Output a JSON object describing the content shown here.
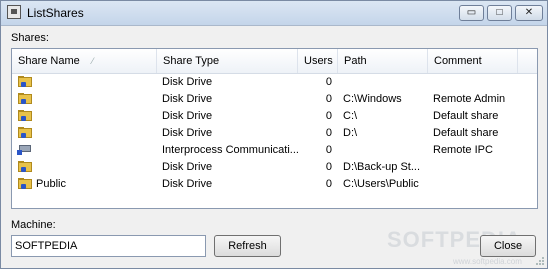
{
  "window": {
    "title": "ListShares"
  },
  "titlebar": {
    "minimize_glyph": "▭",
    "maximize_glyph": "□",
    "close_glyph": "✕"
  },
  "shares": {
    "label": "Shares:",
    "columns": [
      "Share Name",
      "Share Type",
      "Users",
      "Path",
      "Comment"
    ],
    "rows": [
      {
        "icon": "shared-folder-icon",
        "name": "",
        "type": "Disk Drive",
        "users": "0",
        "path": "",
        "comment": ""
      },
      {
        "icon": "shared-folder-icon",
        "name": "",
        "type": "Disk Drive",
        "users": "0",
        "path": "C:\\Windows",
        "comment": "Remote Admin"
      },
      {
        "icon": "shared-folder-icon",
        "name": "",
        "type": "Disk Drive",
        "users": "0",
        "path": "C:\\",
        "comment": "Default share"
      },
      {
        "icon": "shared-folder-icon",
        "name": "",
        "type": "Disk Drive",
        "users": "0",
        "path": "D:\\",
        "comment": "Default share"
      },
      {
        "icon": "ipc-share-icon",
        "name": "",
        "type": "Interprocess Communicati...",
        "users": "0",
        "path": "",
        "comment": "Remote IPC"
      },
      {
        "icon": "shared-folder-icon",
        "name": "",
        "type": "Disk Drive",
        "users": "0",
        "path": "D:\\Back-up St...",
        "comment": ""
      },
      {
        "icon": "shared-folder-icon",
        "name": "Public",
        "type": "Disk Drive",
        "users": "0",
        "path": "C:\\Users\\Public",
        "comment": ""
      }
    ]
  },
  "machine": {
    "label": "Machine:",
    "value": "SOFTPEDIA"
  },
  "buttons": {
    "refresh": "Refresh",
    "close": "Close"
  },
  "watermark": {
    "text": "SOFTPEDIA",
    "url": "www.softpedia.com"
  }
}
